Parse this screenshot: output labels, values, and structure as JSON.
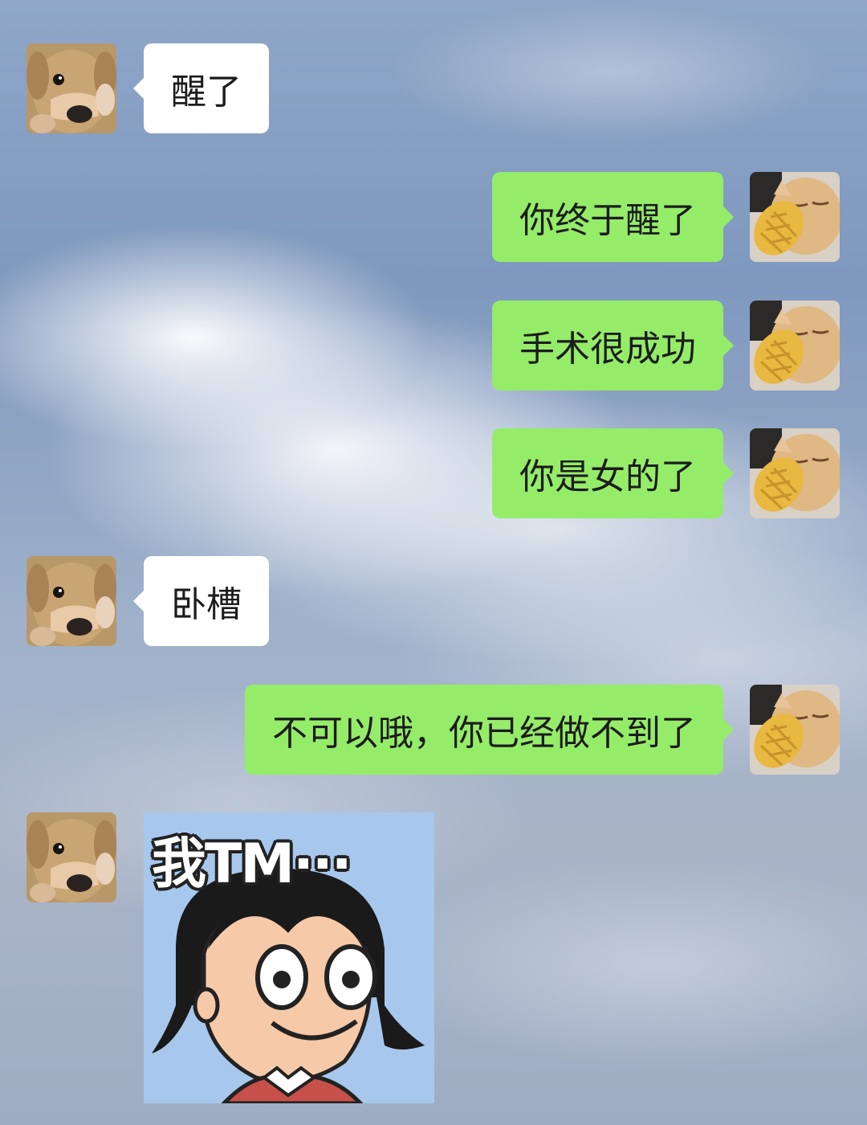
{
  "messages": [
    {
      "side": "left",
      "type": "text",
      "text": "醒了"
    },
    {
      "side": "right",
      "type": "text",
      "text": "你终于醒了"
    },
    {
      "side": "right",
      "type": "text",
      "text": "手术很成功"
    },
    {
      "side": "right",
      "type": "text",
      "text": "你是女的了"
    },
    {
      "side": "left",
      "type": "text",
      "text": "卧槽"
    },
    {
      "side": "right",
      "type": "text",
      "text": "不可以哦，你已经做不到了"
    },
    {
      "side": "left",
      "type": "sticker",
      "text": "我TM···"
    }
  ],
  "avatars": {
    "left": "dog-avatar",
    "right": "cat-avatar"
  },
  "colors": {
    "sent_bubble": "#95ec69",
    "received_bubble": "#ffffff"
  }
}
